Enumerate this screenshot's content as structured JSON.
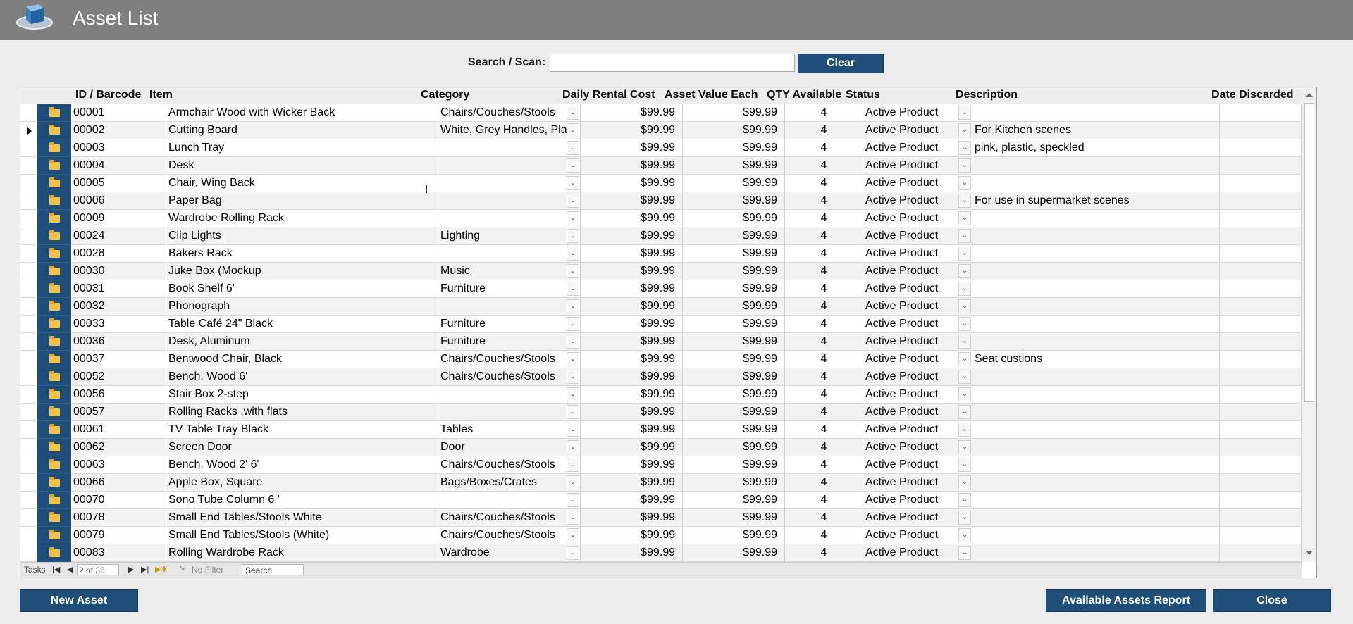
{
  "window": {
    "title": "Asset List"
  },
  "search": {
    "label": "Search / Scan:",
    "value": "",
    "clear_label": "Clear"
  },
  "columns": {
    "id": "ID / Barcode",
    "item": "Item",
    "category": "Category",
    "daily": "Daily Rental Cost",
    "asset": "Asset Value Each",
    "qty": "QTY Available",
    "status": "Status",
    "description": "Description",
    "discarded": "Date Discarded"
  },
  "rows": [
    {
      "id": "00001",
      "item": "Armchair Wood with Wicker Back",
      "category": "Chairs/Couches/Stools",
      "daily": "$99.99",
      "asset": "$99.99",
      "qty": "4",
      "status": "Active Product",
      "description": "",
      "discarded": ""
    },
    {
      "id": "00002",
      "item": "Cutting Board",
      "category": "White, Grey Handles, Pla",
      "daily": "$99.99",
      "asset": "$99.99",
      "qty": "4",
      "status": "Active Product",
      "description": "For Kitchen scenes",
      "discarded": ""
    },
    {
      "id": "00003",
      "item": "Lunch Tray",
      "category": "",
      "daily": "$99.99",
      "asset": "$99.99",
      "qty": "4",
      "status": "Active Product",
      "description": "pink, plastic, speckled",
      "discarded": ""
    },
    {
      "id": "00004",
      "item": "Desk",
      "category": "",
      "daily": "$99.99",
      "asset": "$99.99",
      "qty": "4",
      "status": "Active Product",
      "description": "",
      "discarded": ""
    },
    {
      "id": "00005",
      "item": "Chair, Wing Back",
      "category": "",
      "daily": "$99.99",
      "asset": "$99.99",
      "qty": "4",
      "status": "Active Product",
      "description": "",
      "discarded": ""
    },
    {
      "id": "00006",
      "item": "Paper Bag",
      "category": "",
      "daily": "$99.99",
      "asset": "$99.99",
      "qty": "4",
      "status": "Active Product",
      "description": "For use in supermarket scenes",
      "discarded": ""
    },
    {
      "id": "00009",
      "item": "Wardrobe Rolling Rack",
      "category": "",
      "daily": "$99.99",
      "asset": "$99.99",
      "qty": "4",
      "status": "Active Product",
      "description": "",
      "discarded": ""
    },
    {
      "id": "00024",
      "item": "Clip Lights",
      "category": "Lighting",
      "daily": "$99.99",
      "asset": "$99.99",
      "qty": "4",
      "status": "Active Product",
      "description": "",
      "discarded": ""
    },
    {
      "id": "00028",
      "item": "Bakers Rack",
      "category": "",
      "daily": "$99.99",
      "asset": "$99.99",
      "qty": "4",
      "status": "Active Product",
      "description": "",
      "discarded": ""
    },
    {
      "id": "00030",
      "item": "Juke Box (Mockup",
      "category": "Music",
      "daily": "$99.99",
      "asset": "$99.99",
      "qty": "4",
      "status": "Active Product",
      "description": "",
      "discarded": ""
    },
    {
      "id": "00031",
      "item": "Book Shelf 6'",
      "category": "Furniture",
      "daily": "$99.99",
      "asset": "$99.99",
      "qty": "4",
      "status": "Active Product",
      "description": "",
      "discarded": ""
    },
    {
      "id": "00032",
      "item": "Phonograph",
      "category": "",
      "daily": "$99.99",
      "asset": "$99.99",
      "qty": "4",
      "status": "Active Product",
      "description": "",
      "discarded": ""
    },
    {
      "id": "00033",
      "item": "Table Café 24\" Black",
      "category": "Furniture",
      "daily": "$99.99",
      "asset": "$99.99",
      "qty": "4",
      "status": "Active Product",
      "description": "",
      "discarded": ""
    },
    {
      "id": "00036",
      "item": "Desk, Aluminum",
      "category": "Furniture",
      "daily": "$99.99",
      "asset": "$99.99",
      "qty": "4",
      "status": "Active Product",
      "description": "",
      "discarded": ""
    },
    {
      "id": "00037",
      "item": "Bentwood Chair, Black",
      "category": "Chairs/Couches/Stools",
      "daily": "$99.99",
      "asset": "$99.99",
      "qty": "4",
      "status": "Active Product",
      "description": "Seat custions",
      "discarded": ""
    },
    {
      "id": "00052",
      "item": "Bench, Wood 6'",
      "category": "Chairs/Couches/Stools",
      "daily": "$99.99",
      "asset": "$99.99",
      "qty": "4",
      "status": "Active Product",
      "description": "",
      "discarded": ""
    },
    {
      "id": "00056",
      "item": "Stair Box 2-step",
      "category": "",
      "daily": "$99.99",
      "asset": "$99.99",
      "qty": "4",
      "status": "Active Product",
      "description": "",
      "discarded": ""
    },
    {
      "id": "00057",
      "item": "Rolling Racks ,with flats",
      "category": "",
      "daily": "$99.99",
      "asset": "$99.99",
      "qty": "4",
      "status": "Active Product",
      "description": "",
      "discarded": ""
    },
    {
      "id": "00061",
      "item": "TV Table Tray Black",
      "category": "Tables",
      "daily": "$99.99",
      "asset": "$99.99",
      "qty": "4",
      "status": "Active Product",
      "description": "",
      "discarded": ""
    },
    {
      "id": "00062",
      "item": "Screen Door",
      "category": "Door",
      "daily": "$99.99",
      "asset": "$99.99",
      "qty": "4",
      "status": "Active Product",
      "description": "",
      "discarded": ""
    },
    {
      "id": "00063",
      "item": "Bench, Wood 2' 6'",
      "category": "Chairs/Couches/Stools",
      "daily": "$99.99",
      "asset": "$99.99",
      "qty": "4",
      "status": "Active Product",
      "description": "",
      "discarded": ""
    },
    {
      "id": "00066",
      "item": "Apple Box, Square",
      "category": "Bags/Boxes/Crates",
      "daily": "$99.99",
      "asset": "$99.99",
      "qty": "4",
      "status": "Active Product",
      "description": "",
      "discarded": ""
    },
    {
      "id": "00070",
      "item": "Sono Tube Column 6 '",
      "category": "",
      "daily": "$99.99",
      "asset": "$99.99",
      "qty": "4",
      "status": "Active Product",
      "description": "",
      "discarded": ""
    },
    {
      "id": "00078",
      "item": "Small End Tables/Stools White",
      "category": "Chairs/Couches/Stools",
      "daily": "$99.99",
      "asset": "$99.99",
      "qty": "4",
      "status": "Active Product",
      "description": "",
      "discarded": ""
    },
    {
      "id": "00079",
      "item": "Small End Tables/Stools (White)",
      "category": "Chairs/Couches/Stools",
      "daily": "$99.99",
      "asset": "$99.99",
      "qty": "4",
      "status": "Active Product",
      "description": "",
      "discarded": ""
    },
    {
      "id": "00083",
      "item": "Rolling Wardrobe Rack",
      "category": "Wardrobe",
      "daily": "$99.99",
      "asset": "$99.99",
      "qty": "4",
      "status": "Active Product",
      "description": "",
      "discarded": ""
    }
  ],
  "current_record_index": 1,
  "navigator": {
    "tasks_label": "Tasks",
    "record_text": "2 of 36",
    "filter_label": "No Filter",
    "search_label": "Search"
  },
  "footer": {
    "new_asset_label": "New Asset",
    "report_label": "Available Assets Report",
    "close_label": "Close"
  },
  "colors": {
    "titlebar": "#7f7f7f",
    "button": "#1f4e79",
    "background": "#ededed"
  },
  "icons": {
    "logo": "asset-box-logo",
    "open_record": "folder-icon",
    "dropdown": "chevron-down-icon",
    "record_selector": "record-pointer-icon"
  }
}
